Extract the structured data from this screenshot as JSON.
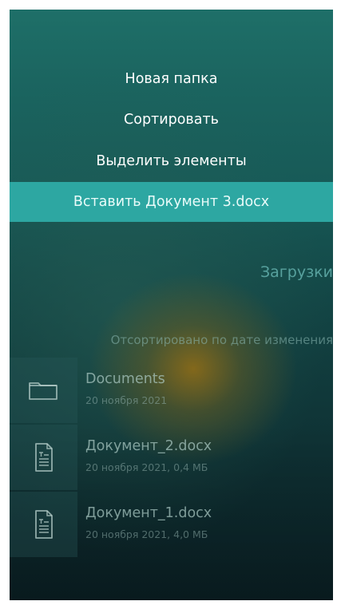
{
  "menu": {
    "items": [
      {
        "label": "Новая папка"
      },
      {
        "label": "Сортировать"
      },
      {
        "label": "Выделить элементы"
      },
      {
        "label": "Вставить Документ 3.docx"
      }
    ]
  },
  "folder": {
    "title": "Загрузки",
    "sort_label": "Отсортировано по дате изменения"
  },
  "files": [
    {
      "name": "Documents",
      "meta": "20 ноября 2021",
      "icon": "folder-icon"
    },
    {
      "name": "Документ_2.docx",
      "meta": "20 ноября 2021, 0,4 МБ",
      "icon": "document-icon"
    },
    {
      "name": "Документ_1.docx",
      "meta": "20 ноября 2021, 4,0 МБ",
      "icon": "document-icon"
    }
  ],
  "colors": {
    "highlight": "#2da7a2",
    "background_top": "#1e6f68",
    "background_bottom": "#0c2328",
    "text": "#ffffff"
  }
}
